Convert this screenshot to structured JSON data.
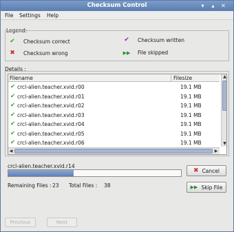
{
  "window": {
    "title": "Checksum Control",
    "controls": [
      "▾",
      "▴",
      "✕"
    ]
  },
  "menu": [
    "File",
    "Settings",
    "Help"
  ],
  "legend": {
    "label": "Legend:",
    "items": [
      {
        "icon": "checkmark-icon",
        "glyph": "✔",
        "color": "#3f9a2a",
        "label": "Checksum correct"
      },
      {
        "icon": "checkmark-written-icon",
        "glyph": "✔",
        "color": "#8a2a9a",
        "label": "Checksum written"
      },
      {
        "icon": "cross-icon",
        "glyph": "✖",
        "color": "#c83030",
        "label": "Checksum wrong"
      },
      {
        "icon": "skip-icon",
        "glyph": "▶▶",
        "color": "#2f8d28",
        "label": "File skipped"
      }
    ]
  },
  "details": {
    "label": "Details :",
    "columns": {
      "filename": "Filename",
      "filesize": "Filesize"
    },
    "rows": [
      {
        "name": "crcl-alien.teacher.xvid.r00",
        "size": "19.1 MB"
      },
      {
        "name": "crcl-alien.teacher.xvid.r01",
        "size": "19.1 MB"
      },
      {
        "name": "crcl-alien.teacher.xvid.r02",
        "size": "19.1 MB"
      },
      {
        "name": "crcl-alien.teacher.xvid.r03",
        "size": "19.1 MB"
      },
      {
        "name": "crcl-alien.teacher.xvid.r04",
        "size": "19.1 MB"
      },
      {
        "name": "crcl-alien.teacher.xvid.r05",
        "size": "19.1 MB"
      },
      {
        "name": "crcl-alien.teacher.xvid.r06",
        "size": "19.1 MB"
      }
    ]
  },
  "progress": {
    "current_file": "crcl-alien.teacher.xvid.r14",
    "fraction": 0.38
  },
  "stats": {
    "remaining_label": "Remaining Files :",
    "remaining": "23",
    "total_label": "Total Files :",
    "total": "38"
  },
  "buttons": {
    "cancel": "Cancel",
    "skip": "Skip File",
    "previous": "Previous",
    "next": "Next"
  }
}
